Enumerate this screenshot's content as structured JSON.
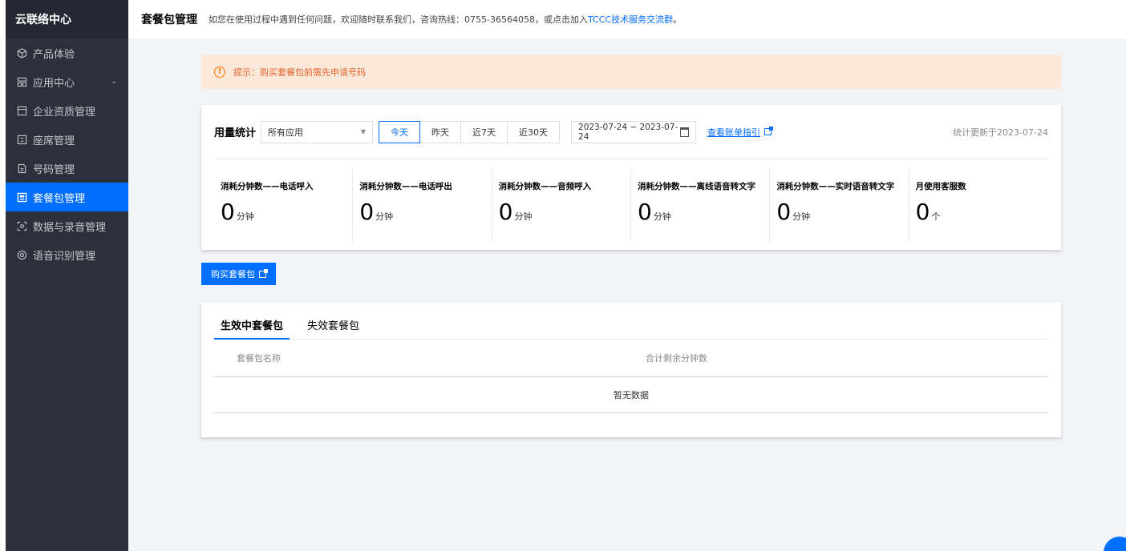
{
  "sidebar": {
    "title": "云联络中心",
    "items": [
      {
        "label": "产品体验",
        "icon": "cube-icon"
      },
      {
        "label": "应用中心",
        "icon": "grid-icon",
        "chevron": "⌄"
      },
      {
        "label": "企业资质管理",
        "icon": "card-icon"
      },
      {
        "label": "座席管理",
        "icon": "seat-icon"
      },
      {
        "label": "号码管理",
        "icon": "document-icon"
      },
      {
        "label": "套餐包管理",
        "icon": "package-icon",
        "active": true
      },
      {
        "label": "数据与录音管理",
        "icon": "scan-icon"
      },
      {
        "label": "语音识别管理",
        "icon": "voice-icon"
      }
    ]
  },
  "header": {
    "title": "套餐包管理",
    "desc": "如您在使用过程中遇到任何问题，欢迎随时联系我们，咨询热线：0755-36564058，或点击加入",
    "link": "TCCC技术服务交流群",
    "suffix": "。"
  },
  "alert": {
    "text": "提示：购买套餐包前需先申请号码",
    "icon": "warning-icon"
  },
  "usage": {
    "label": "用量统计",
    "app_select": "所有应用",
    "ranges": [
      "今天",
      "昨天",
      "近7天",
      "近30天"
    ],
    "active_range": "今天",
    "date_range": "2023-07-24  ~ 2023-07-24",
    "guide_link": "查看账单指引",
    "updated": "统计更新于2023-07-24",
    "stats": [
      {
        "name": "消耗分钟数——电话呼入",
        "value": "0",
        "unit": "分钟"
      },
      {
        "name": "消耗分钟数——电话呼出",
        "value": "0",
        "unit": "分钟"
      },
      {
        "name": "消耗分钟数——音频呼入",
        "value": "0",
        "unit": "分钟"
      },
      {
        "name": "消耗分钟数——离线语音转文字",
        "value": "0",
        "unit": "分钟"
      },
      {
        "name": "消耗分钟数——实时语音转文字",
        "value": "0",
        "unit": "分钟"
      },
      {
        "name": "月使用客服数",
        "value": "0",
        "unit": "个"
      }
    ]
  },
  "buy_button": "购买套餐包",
  "table": {
    "tabs": [
      "生效中套餐包",
      "失效套餐包"
    ],
    "active_tab": "生效中套餐包",
    "columns": [
      "套餐包名称",
      "合计剩余分钟数"
    ],
    "empty_text": "暂无数据"
  },
  "colors": {
    "primary": "#006eff",
    "sidebar": "#2b303b",
    "alert_bg": "#fbe8d8"
  }
}
